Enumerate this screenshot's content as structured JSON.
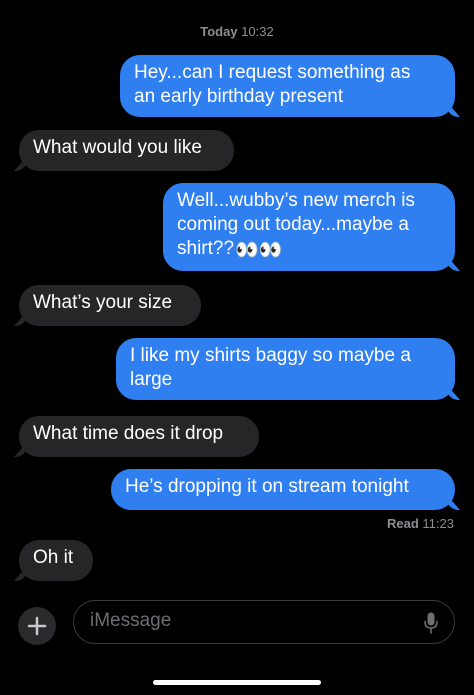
{
  "thread": {
    "timestamp_day": "Today",
    "timestamp_time": "10:32",
    "messages": [
      {
        "from": "me",
        "lines": [
          "Hey...can I request something as",
          "an early birthday present"
        ]
      },
      {
        "from": "them",
        "lines": [
          "What would you like"
        ]
      },
      {
        "from": "me",
        "lines": [
          "Well...wubby’s new merch is",
          "coming out today...maybe a",
          "shirt??"
        ],
        "trailing_emoji": "👀👀"
      },
      {
        "from": "them",
        "lines": [
          "What’s your size"
        ]
      },
      {
        "from": "me",
        "lines": [
          "I like my shirts baggy so maybe a",
          "large"
        ]
      },
      {
        "from": "them",
        "lines": [
          "What time does it drop"
        ]
      },
      {
        "from": "me",
        "lines": [
          "He’s dropping it on stream tonight"
        ]
      },
      {
        "from": "them",
        "lines": [
          "Oh it"
        ]
      }
    ],
    "read_label": "Read",
    "read_time": "11:23"
  },
  "compose": {
    "plus_icon": "plus-icon",
    "placeholder": "iMessage",
    "mic_icon": "microphone-icon"
  },
  "colors": {
    "sent_bubble": "#2f7ff0",
    "received_bubble": "#262628",
    "background": "#000000"
  }
}
